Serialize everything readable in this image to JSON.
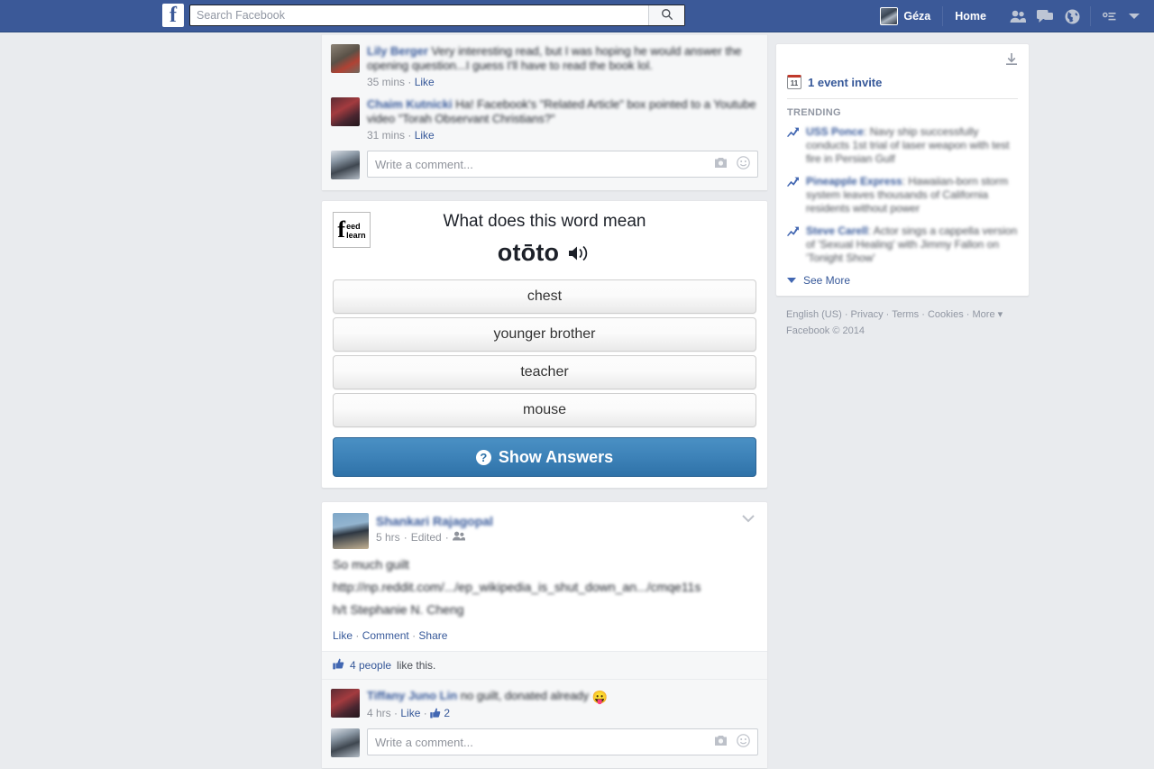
{
  "navbar": {
    "logo": "f",
    "search_placeholder": "Search Facebook",
    "search_value": "",
    "search_icon": "search-icon",
    "profile_name": "Géza",
    "home_label": "Home",
    "icons": [
      "friend-requests-icon",
      "messages-icon",
      "notifications-globe-icon",
      "privacy-shortcuts-icon",
      "account-settings-caret-icon"
    ]
  },
  "top_post": {
    "comments": [
      {
        "author": "Lily Berger",
        "text": "Very interesting read, but I was hoping he would answer the opening question...I guess I'll have to read the book lol.",
        "time": "35 mins",
        "like_label": "Like"
      },
      {
        "author": "Chaim Kutnicki",
        "text": "Ha! Facebook's \"Related Article\" box pointed to a Youtube video \"Torah Observant Christians?\"",
        "time": "31 mins",
        "like_label": "Like"
      }
    ],
    "comment_box_placeholder": "Write a comment...",
    "camera_icon": "camera-icon",
    "emoji_icon": "emoji-icon"
  },
  "quiz": {
    "logo": {
      "f": "f",
      "line1": "eed",
      "line2": "learn"
    },
    "title": "What does this word mean",
    "word": "otōto",
    "speaker_icon": "speaker-icon",
    "answers": [
      "chest",
      "younger brother",
      "teacher",
      "mouse"
    ],
    "show_answers_label": "Show Answers",
    "show_answers_icon": "question-mark-icon"
  },
  "story_post": {
    "author": "Shankari Rajagopal",
    "time": "5 hrs",
    "edited_label": "Edited",
    "audience_icon": "friends-audience-icon",
    "chevron_icon": "chevron-down-icon",
    "body_line1": "So much guilt",
    "body_link": "http://np.reddit.com/.../ep_wikipedia_is_shut_down_an.../cmqe11s",
    "body_line3": "h/t Stephanie N. Cheng",
    "actions": {
      "like": "Like",
      "comment": "Comment",
      "share": "Share",
      "sep": "·"
    },
    "likebar": {
      "thumb_icon": "thumbs-up-icon",
      "count": "4 people",
      "suffix": "like this."
    },
    "comment": {
      "author": "Tiffany Juno Lin",
      "text": "no guilt, donated already",
      "emoji": "😛",
      "time": "4 hrs",
      "like_label": "Like",
      "like_icon": "thumbs-up-icon",
      "like_count": "2"
    },
    "comment_box_placeholder": "Write a comment...",
    "camera_icon": "camera-icon",
    "emoji_icon": "emoji-icon"
  },
  "sidebar": {
    "download_icon": "download-icon",
    "event_invite": {
      "icon_day": "11",
      "label": "1 event invite"
    },
    "trending_header": "TRENDING",
    "trending": [
      {
        "icon": "trending-arrow-icon",
        "topic": "USS Ponce",
        "description": ": Navy ship successfully conducts 1st trial of laser weapon with test fire in Persian Gulf"
      },
      {
        "icon": "trending-arrow-icon",
        "topic": "Pineapple Express",
        "description": ": Hawaiian-born storm system leaves thousands of California residents without power"
      },
      {
        "icon": "trending-arrow-icon",
        "topic": "Steve Carell",
        "description": ": Actor sings a cappella version of 'Sexual Healing' with Jimmy Fallon on 'Tonight Show'"
      }
    ],
    "see_more": "See More"
  },
  "footer": {
    "links": [
      "English (US)",
      "Privacy",
      "Terms",
      "Cookies",
      "More"
    ],
    "links_line": "English (US) · Privacy · Terms · Cookies · More ",
    "copyright": "Facebook © 2014"
  },
  "colors": {
    "fb_blue": "#3b5998",
    "link_blue": "#365899",
    "page_bg": "#e9ebee",
    "button_blue": "#3d82b8"
  }
}
